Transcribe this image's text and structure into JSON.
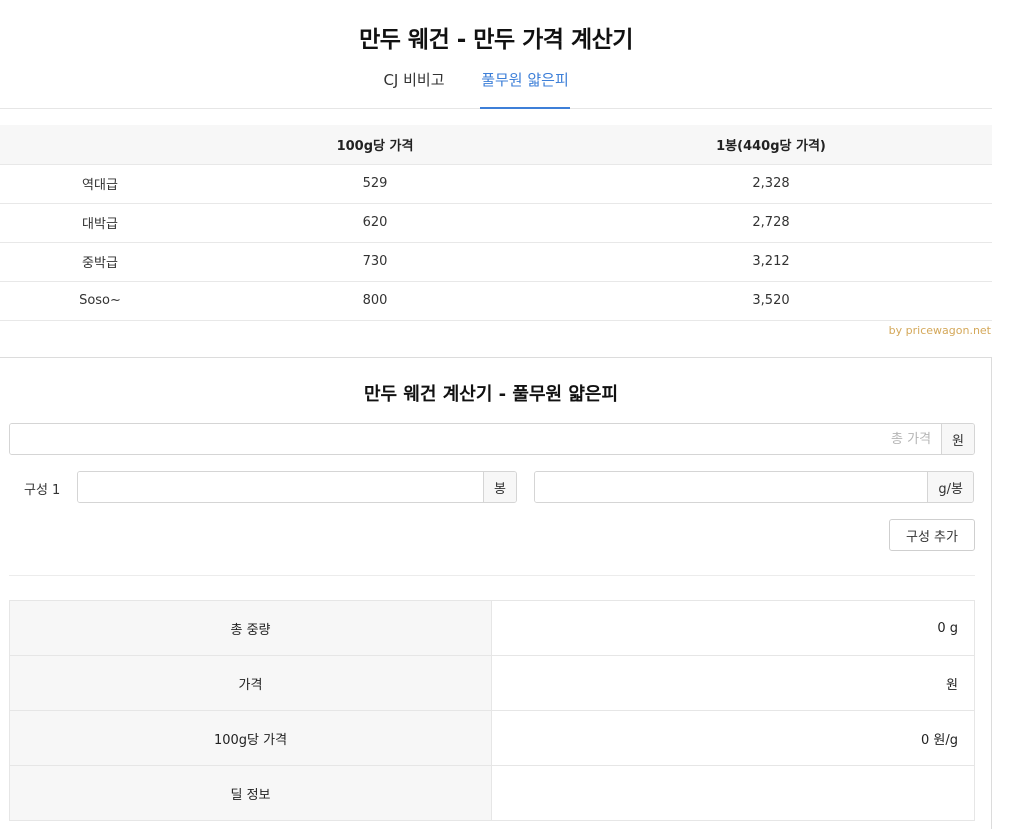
{
  "header": {
    "title": "만두 웨건 - 만두 가격 계산기"
  },
  "tabs": [
    {
      "label": "CJ 비비고",
      "active": false
    },
    {
      "label": "풀무원 얇은피",
      "active": true
    }
  ],
  "price_table": {
    "headers": [
      "",
      "100g당 가격",
      "1봉(440g당 가격)"
    ],
    "rows": [
      {
        "grade": "역대급",
        "per100g": "529",
        "perBag": "2,328"
      },
      {
        "grade": "대박급",
        "per100g": "620",
        "perBag": "2,728"
      },
      {
        "grade": "중박급",
        "per100g": "730",
        "perBag": "3,212"
      },
      {
        "grade": "Soso~",
        "per100g": "800",
        "perBag": "3,520"
      }
    ]
  },
  "credit": "by pricewagon.net",
  "calculator": {
    "title": "만두 웨건 계산기 - 풀무원 얇은피",
    "total_price": {
      "placeholder": "총 가격",
      "value": "",
      "unit": "원"
    },
    "component_label": "구성 1",
    "count_input": {
      "value": "",
      "unit": "봉"
    },
    "weight_input": {
      "value": "",
      "unit": "g/봉"
    },
    "add_button": "구성 추가",
    "results": [
      {
        "label": "총 중량",
        "value": "0 g"
      },
      {
        "label": "가격",
        "value": "원"
      },
      {
        "label": "100g당 가격",
        "value": "0 원/g"
      },
      {
        "label": "딜 정보",
        "value": ""
      }
    ]
  },
  "colors": {
    "accent": "#3d7fd8",
    "credit": "#d4a85a",
    "header_bg": "#f7f7f7"
  }
}
